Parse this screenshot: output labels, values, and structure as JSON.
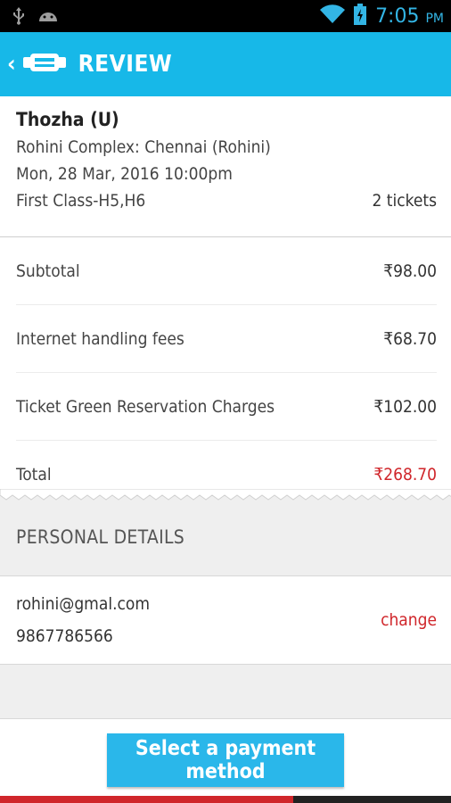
{
  "status_bar": {
    "time": "7:05",
    "ampm": "PM",
    "icons": [
      "usb-icon",
      "android-icon",
      "wifi-icon",
      "battery-icon"
    ]
  },
  "app_bar": {
    "title": "REVIEW",
    "back_icon": "chevron-left-icon",
    "logo_icon": "app-logo-icon"
  },
  "movie": {
    "name": "Thozha (U)",
    "venue": "Rohini Complex: Chennai (Rohini)",
    "datetime": "Mon, 28 Mar, 2016 10:00pm",
    "seats": "First Class-H5,H6",
    "tickets": "2 tickets"
  },
  "charges": [
    {
      "label": "Subtotal",
      "amount": "₹98.00"
    },
    {
      "label": "Internet handling fees",
      "amount": "₹68.70"
    },
    {
      "label": "Ticket Green Reservation Charges",
      "amount": "₹102.00"
    },
    {
      "label": "Total",
      "amount": "₹268.70"
    }
  ],
  "personal": {
    "header": "PERSONAL DETAILS",
    "email": "rohini@gmal.com",
    "phone": "9867786566",
    "change_label": "change"
  },
  "footer": {
    "button_label": "Select a payment method",
    "progress": 0.65
  },
  "colors": {
    "accent": "#17b8e8",
    "status_icons": "#33b5e5",
    "highlight": "#d0262b"
  }
}
